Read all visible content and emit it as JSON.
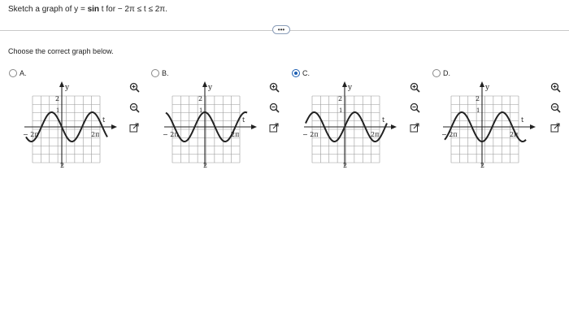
{
  "question": {
    "prefix": "Sketch a graph of y = ",
    "fn": "sin",
    "suffix": " t for  − 2π ≤ t ≤ 2π."
  },
  "more_button": "•••",
  "prompt": "Choose the correct graph below.",
  "options": [
    {
      "letter": "A.",
      "selected": false,
      "x_left": "− 2π",
      "x_right": "2π",
      "y_top": "2",
      "y_one": "1",
      "y_bottom": "2",
      "y_axis": "y",
      "x_axis": "t"
    },
    {
      "letter": "B.",
      "selected": false,
      "x_left": "− 2π",
      "x_right": "2π",
      "y_top": "2",
      "y_one": "1",
      "y_bottom": "2",
      "y_axis": "y",
      "x_axis": "t"
    },
    {
      "letter": "C.",
      "selected": true,
      "x_left": "− 2π",
      "x_right": "2π",
      "y_top": "2",
      "y_one": "1",
      "y_bottom": "2",
      "y_axis": "y",
      "x_axis": "t"
    },
    {
      "letter": "D.",
      "selected": false,
      "x_left": "− 2π",
      "x_right": "2π",
      "y_top": "2",
      "y_one": "1",
      "y_bottom": "2",
      "y_axis": "y",
      "x_axis": "t"
    }
  ],
  "tool_icons": [
    "zoom-in-icon",
    "zoom-out-icon",
    "open-external-icon"
  ],
  "colors": {
    "accent": "#1d5fb3",
    "curve": "#222222",
    "grid": "#9a9a9a"
  }
}
